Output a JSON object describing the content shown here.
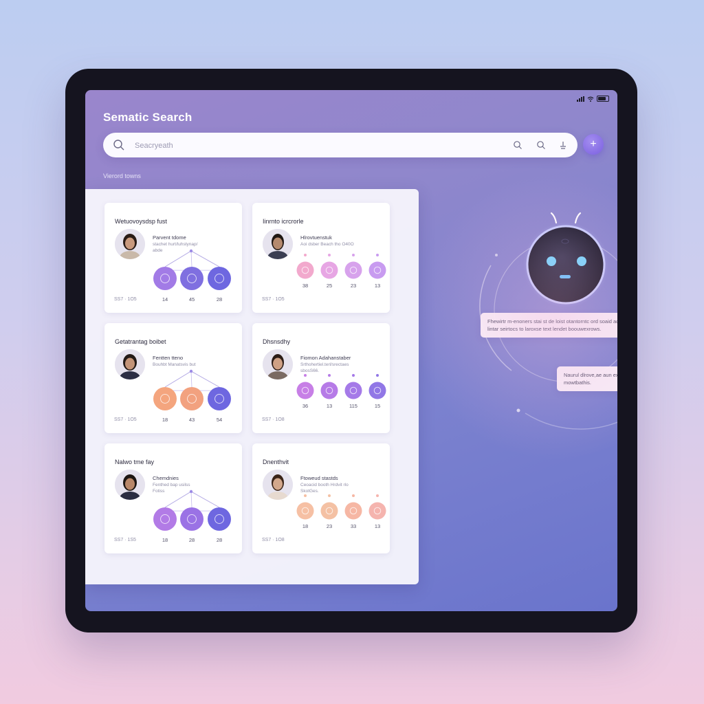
{
  "app": {
    "title": "Sematic Search",
    "status_icons": [
      "signal-icon",
      "wifi-icon",
      "battery-icon"
    ]
  },
  "search": {
    "placeholder": "Seacryeath",
    "buttons": [
      "search-icon",
      "search-icon",
      "filter-icon"
    ],
    "fab_label": "+"
  },
  "section_label": "Vierord towns",
  "cards": [
    {
      "title": "Wetuovoysdsp fust",
      "subtitle": "Parvent tdome",
      "desc": "stachet hurt/luhstynap/",
      "desc2": "abde",
      "footer": "SS7 · 1O5",
      "node_values": [
        "14",
        "45",
        "28"
      ],
      "node_colors": [
        "#a27be6",
        "#7f6fe0",
        "#6e67e0"
      ]
    },
    {
      "title": "Iinrnto icrcrorle",
      "subtitle": "Hlrovtuenstuk",
      "desc": "Aoi dsber Beach tho O40O",
      "desc2": "",
      "footer": "SS7 · 1O5",
      "node_values": [
        "38",
        "25",
        "23",
        "13"
      ],
      "node_colors": [
        "#f2a9cd",
        "#e7a6e4",
        "#d7a2ec",
        "#c89bf0"
      ]
    },
    {
      "title": "Getatrantag boibet",
      "subtitle": "Fentten tteno",
      "desc": "Bouhbt Manatsvis but",
      "desc2": "",
      "footer": "SS7 · 1O5",
      "node_values": [
        "18",
        "43",
        "54"
      ],
      "node_colors": [
        "#f4a57e",
        "#f2a17f",
        "#6e67e0"
      ]
    },
    {
      "title": "Dhsnsdhy",
      "subtitle": "Fiomon Adahanstaber",
      "desc": "Srthohertiel.terl/srectaes",
      "desc2": "sbosS66.",
      "footer": "SS7 · 1O8",
      "node_values": [
        "36",
        "13",
        "115",
        "15"
      ],
      "node_colors": [
        "#c77fe6",
        "#b67be7",
        "#a57ae8",
        "#9177e6"
      ]
    },
    {
      "title": "Nalwo tme fay",
      "subtitle": "Chemdnies",
      "desc": "Fenthed bap usilss",
      "desc2": "Fotiss",
      "footer": "SS7 · 1S5",
      "node_values": [
        "18",
        "28",
        "28"
      ],
      "node_colors": [
        "#b27be6",
        "#9a72e5",
        "#6e67e0"
      ]
    },
    {
      "title": "Dnenthvit",
      "subtitle": "Ftoweud stastds",
      "desc": "Ceoacid booth Hrdvit rlo",
      "desc2": "SkotGes.",
      "footer": "SS7 · 1O8",
      "node_values": [
        "18",
        "23",
        "33",
        "13"
      ],
      "node_colors": [
        "#f6c0a4",
        "#f4c1a4",
        "#f6b7a4",
        "#f5b4ae"
      ]
    }
  ],
  "assistant": {
    "name": "robot-assistant",
    "bubble1": "Fhewirtr m-enoners stai st de loist otantorntc ord soaid ao lintar seirtocs to laroxse text lendet boouwexrows.",
    "bubble2": "Naurul dlrove,ae aun exnd mowtbathis."
  }
}
